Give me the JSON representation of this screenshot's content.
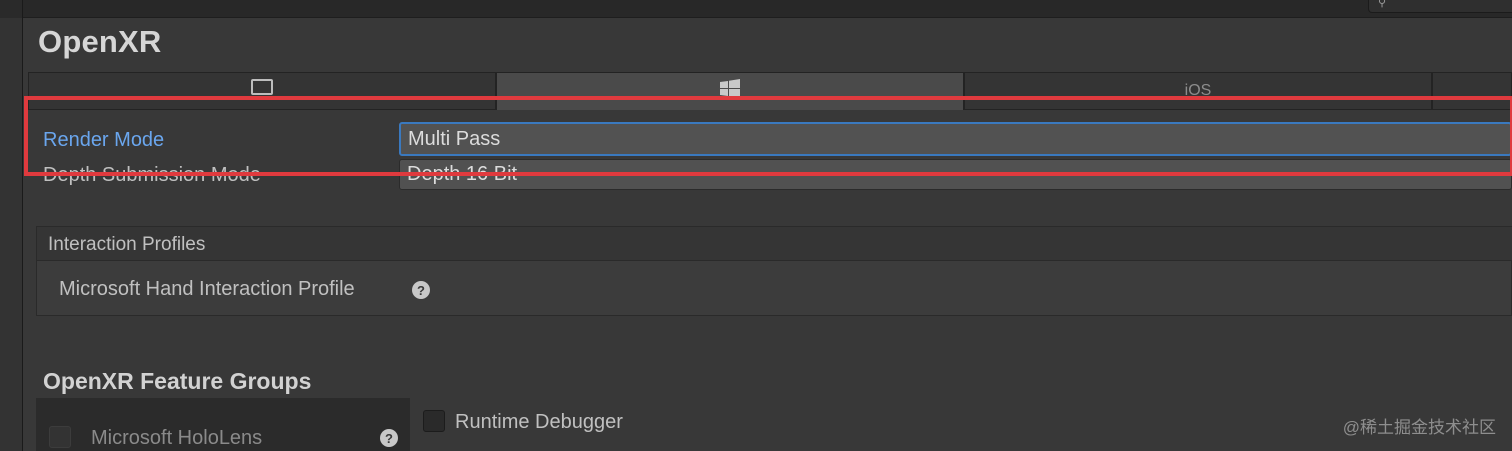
{
  "window": {
    "title": "OpenXR"
  },
  "tabs": [
    {
      "label": "",
      "icon": "monitor-icon"
    },
    {
      "label": "",
      "icon": "windows-logo-icon",
      "active": true
    },
    {
      "label": "iOS",
      "icon": ""
    },
    {
      "label": "",
      "icon": ""
    }
  ],
  "settings": {
    "render_mode": {
      "label": "Render Mode",
      "value": "Multi Pass"
    },
    "depth_submission": {
      "label": "Depth Submission Mode",
      "value": "Depth 16 Bit"
    }
  },
  "interaction_profiles": {
    "header": "Interaction Profiles",
    "items": [
      {
        "label": "Microsoft Hand Interaction Profile",
        "icon": "help-icon"
      }
    ]
  },
  "feature_groups": {
    "title": "OpenXR Feature Groups",
    "groups": [
      {
        "label": "Microsoft HoloLens",
        "icon": "help-icon"
      }
    ],
    "features": [
      {
        "label": "Runtime Debugger"
      }
    ]
  },
  "watermark": "@稀土掘金技术社区",
  "colors": {
    "highlight": "#e03a3e",
    "focus": "#3a79bf",
    "label_focused": "#6aa6ee",
    "background": "#383838"
  }
}
